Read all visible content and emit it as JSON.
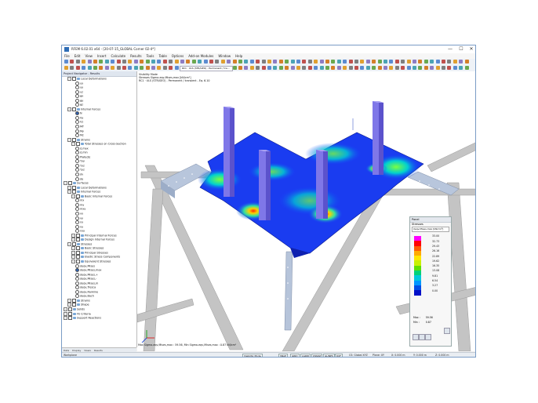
{
  "window": {
    "title": "RFEM 6.02.01 x64 - [20-07-15_GLOBAL Corner 02-4*]",
    "controls": [
      "—",
      "☐",
      "✕"
    ]
  },
  "menu": [
    "File",
    "Edit",
    "View",
    "Insert",
    "Calculate",
    "Results",
    "Tools",
    "Table",
    "Options",
    "Add-on Modules",
    "Window",
    "Help"
  ],
  "toolbar": {
    "load_case": "RC1 · ULS (STR/GEO) - Permanent / tra..."
  },
  "navigator": {
    "title": "Project Navigator - Results",
    "items": [
      {
        "label": "Local Deformations",
        "depth": 1,
        "type": "folder"
      },
      {
        "label": "ux",
        "depth": 3,
        "type": "radio"
      },
      {
        "label": "uy",
        "depth": 3,
        "type": "radio"
      },
      {
        "label": "uz",
        "depth": 3,
        "type": "radio"
      },
      {
        "label": "φx",
        "depth": 3,
        "type": "radio"
      },
      {
        "label": "φy",
        "depth": 3,
        "type": "radio"
      },
      {
        "label": "φz",
        "depth": 3,
        "type": "radio"
      },
      {
        "label": "Internal Forces",
        "depth": 1,
        "type": "folder"
      },
      {
        "label": "N",
        "depth": 3,
        "type": "radio",
        "on": true
      },
      {
        "label": "Vy",
        "depth": 3,
        "type": "radio"
      },
      {
        "label": "Vz",
        "depth": 3,
        "type": "radio"
      },
      {
        "label": "MT",
        "depth": 3,
        "type": "radio"
      },
      {
        "label": "My",
        "depth": 3,
        "type": "radio"
      },
      {
        "label": "Mz",
        "depth": 3,
        "type": "radio"
      },
      {
        "label": "Strains",
        "depth": 1,
        "type": "folder"
      },
      {
        "label": "Total Stresses on Cross-Section",
        "depth": 2,
        "type": "folder"
      },
      {
        "label": "σ,max",
        "depth": 3,
        "type": "radio"
      },
      {
        "label": "σ,min",
        "depth": 3,
        "type": "radio"
      },
      {
        "label": "Plate(b)",
        "depth": 3,
        "type": "radio"
      },
      {
        "label": "τxy",
        "depth": 3,
        "type": "radio"
      },
      {
        "label": "τxz",
        "depth": 3,
        "type": "radio"
      },
      {
        "label": "τyz",
        "depth": 3,
        "type": "radio"
      },
      {
        "label": "σv",
        "depth": 3,
        "type": "radio"
      },
      {
        "label": "σe",
        "depth": 3,
        "type": "radio"
      },
      {
        "label": "Surfaces",
        "depth": 0,
        "type": "check"
      },
      {
        "label": "Local Deformations",
        "depth": 1,
        "type": "folder"
      },
      {
        "label": "Internal Forces",
        "depth": 1,
        "type": "folder"
      },
      {
        "label": "Basic Internal Forces",
        "depth": 2,
        "type": "folder"
      },
      {
        "label": "mx",
        "depth": 3,
        "type": "radio"
      },
      {
        "label": "my",
        "depth": 3,
        "type": "radio"
      },
      {
        "label": "mxy",
        "depth": 3,
        "type": "radio"
      },
      {
        "label": "vx",
        "depth": 3,
        "type": "radio"
      },
      {
        "label": "vy",
        "depth": 3,
        "type": "radio"
      },
      {
        "label": "nx",
        "depth": 3,
        "type": "radio"
      },
      {
        "label": "ny",
        "depth": 3,
        "type": "radio"
      },
      {
        "label": "nxy",
        "depth": 3,
        "type": "radio"
      },
      {
        "label": "Principal Internal Forces",
        "depth": 2,
        "type": "folder"
      },
      {
        "label": "Design Internal Forces",
        "depth": 2,
        "type": "folder"
      },
      {
        "label": "Stresses",
        "depth": 1,
        "type": "folder"
      },
      {
        "label": "Basic Stresses",
        "depth": 2,
        "type": "folder"
      },
      {
        "label": "Principal Stresses",
        "depth": 2,
        "type": "folder"
      },
      {
        "label": "Elastic Stress Components",
        "depth": 2,
        "type": "folder"
      },
      {
        "label": "Equivalent Stresses",
        "depth": 2,
        "type": "folder"
      },
      {
        "label": "σeqv,Mises",
        "depth": 3,
        "type": "radio"
      },
      {
        "label": "σeqv,Mises,max",
        "depth": 3,
        "type": "radio",
        "on": true
      },
      {
        "label": "σeqv,Mises,+",
        "depth": 3,
        "type": "radio"
      },
      {
        "label": "σeqv,Mises,-",
        "depth": 3,
        "type": "radio"
      },
      {
        "label": "σeqv,Mises,m",
        "depth": 3,
        "type": "radio"
      },
      {
        "label": "σeqv,Tresca",
        "depth": 3,
        "type": "radio"
      },
      {
        "label": "σeqv,Rankine",
        "depth": 3,
        "type": "radio"
      },
      {
        "label": "σeqv,Bach",
        "depth": 3,
        "type": "radio"
      },
      {
        "label": "Strains",
        "depth": 1,
        "type": "folder"
      },
      {
        "label": "Shape",
        "depth": 1,
        "type": "folder"
      },
      {
        "label": "Solids",
        "depth": 0,
        "type": "check"
      },
      {
        "label": "FE Criteria",
        "depth": 0,
        "type": "check"
      },
      {
        "label": "Support Reactions",
        "depth": 0,
        "type": "check"
      }
    ],
    "tabs": [
      "Data",
      "Display",
      "Views",
      "Results"
    ]
  },
  "view": {
    "info": [
      "Visibility Mode",
      "Stresses  Sigma-eqv,Mises,max [kN/cm²]",
      "RC1 · ULS (STR/GEO) - Permanent / transient - Eq. 6.10"
    ],
    "footer": "Max Sigma-eqv,Mises,max : 59.56, Min Sigma-eqv,Mises,max : 0.87 kN/cm²"
  },
  "panel": {
    "title": "Panel",
    "heading": "Stresses",
    "quantity": "σeqv,Mises,max [kN/cm²]",
    "legend": {
      "values": [
        "33.00",
        "32.73",
        "29.43",
        "26.16",
        "22.89",
        "19.62",
        "16.35",
        "13.08",
        "9.81",
        "6.54",
        "3.27",
        "0.00"
      ],
      "colors": [
        "#ff00ff",
        "#ff0000",
        "#ff5a00",
        "#ffaa00",
        "#ffe600",
        "#c8f000",
        "#5fe000",
        "#00d278",
        "#00c8dc",
        "#0096ff",
        "#004ee6",
        "#0010c8"
      ]
    },
    "max_label": "Max :",
    "max_value": "59.56",
    "min_label": "Min :",
    "min_value": "0.87"
  },
  "statusbar": {
    "left": "Workplane",
    "buttons": [
      "SNAP",
      "GRID",
      "LGRID",
      "OSNAP",
      "GLINES",
      "DXF",
      "Visibility Mode"
    ],
    "right": [
      "CS: Global XYZ",
      "Plane: XY",
      "X: 0.000 m",
      "Y: 0.000 m",
      "Z: 0.000 m"
    ]
  }
}
